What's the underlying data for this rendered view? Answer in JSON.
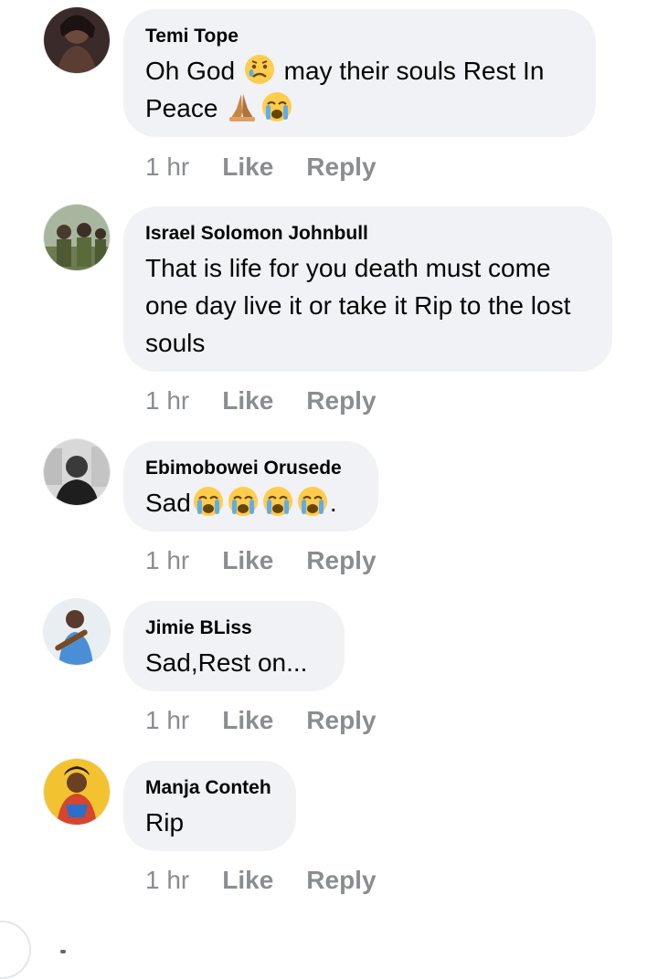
{
  "comments": [
    {
      "author": "Temi Tope",
      "text_parts": [
        "Oh God ",
        " may their souls Rest In Peace "
      ],
      "emojis": [
        "sad-but-relieved-face",
        "folded-hands",
        "loudly-crying-face"
      ],
      "time": "1 hr",
      "like": "Like",
      "reply": "Reply"
    },
    {
      "author": "Israel Solomon Johnbull",
      "text": "That is life for you  death must come one day live it or take it  Rip to the lost souls",
      "time": "1 hr",
      "like": "Like",
      "reply": "Reply"
    },
    {
      "author": "Ebimobowei Orusede",
      "text_parts": [
        "Sad",
        "."
      ],
      "emojis": [
        "loudly-crying-face",
        "loudly-crying-face",
        "loudly-crying-face",
        "loudly-crying-face"
      ],
      "time": "1 hr",
      "like": "Like",
      "reply": "Reply"
    },
    {
      "author": "Jimie BLiss",
      "text": "Sad,Rest on...",
      "time": "1 hr",
      "like": "Like",
      "reply": "Reply"
    },
    {
      "author": "Manja Conteh",
      "text": "Rip",
      "time": "1 hr",
      "like": "Like",
      "reply": "Reply"
    }
  ],
  "colors": {
    "bubble": "#f0f2f5",
    "meta": "#8a8d91",
    "text": "#050505"
  }
}
